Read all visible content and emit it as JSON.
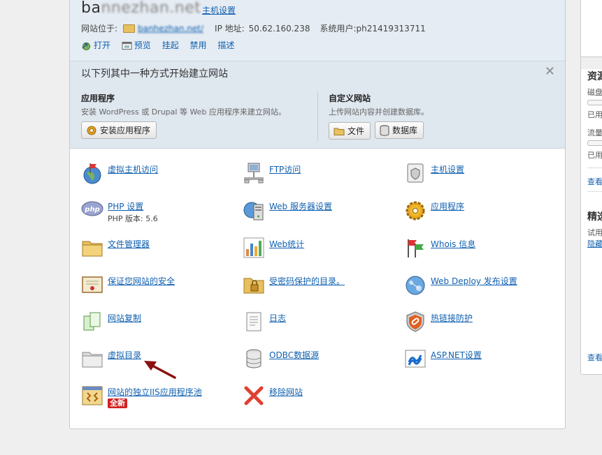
{
  "site": {
    "domain_visible": "ba",
    "domain_blurred": "nnezhan.net",
    "host_settings_link": "主机设置",
    "location_label": "网站位于:",
    "location_url_blurred": "banhezhan.net/",
    "ip_label": "IP 地址:",
    "ip_value": "50.62.160.238",
    "sysuser_label": "系统用户:",
    "sysuser_value": "ph21419313711",
    "actions": [
      {
        "label": "打开",
        "icon": "open-icon"
      },
      {
        "label": "预览",
        "icon": "preview-icon"
      },
      {
        "label": "挂起"
      },
      {
        "label": "禁用"
      },
      {
        "label": "描述"
      }
    ]
  },
  "start": {
    "title": "以下列其中一种方式开始建立网站",
    "close": "✕",
    "apps": {
      "title": "应用程序",
      "desc": "安装 WordPress 或 Drupal 等 Web 应用程序来建立网站。",
      "button": "安装应用程序"
    },
    "custom": {
      "title": "自定义网站",
      "desc": "上传网站内容并创建数据库。",
      "file_button": "文件",
      "db_button": "数据库"
    }
  },
  "tools": [
    {
      "label": "虚拟主机访问",
      "icon": "globe-flag-icon"
    },
    {
      "label": "FTP访问",
      "icon": "ftp-network-icon"
    },
    {
      "label": "主机设置",
      "icon": "hosting-settings-icon"
    },
    {
      "label": "PHP 设置",
      "sub": "PHP 版本: 5.6",
      "icon": "php-icon"
    },
    {
      "label": "Web 服务器设置",
      "icon": "web-server-icon"
    },
    {
      "label": "应用程序",
      "icon": "gear-icon"
    },
    {
      "label": "文件管理器",
      "icon": "folder-icon"
    },
    {
      "label": "Web统计",
      "icon": "bar-chart-icon"
    },
    {
      "label": "Whois 信息",
      "icon": "flags-icon"
    },
    {
      "label": "保证您网站的安全",
      "icon": "certificate-icon"
    },
    {
      "label": "受密码保护的目录。",
      "icon": "locked-folder-icon"
    },
    {
      "label": "Web Deploy 发布设置",
      "icon": "web-deploy-icon"
    },
    {
      "label": "网站复制",
      "icon": "copy-pages-icon"
    },
    {
      "label": "日志",
      "icon": "log-document-icon"
    },
    {
      "label": "热链接防护",
      "icon": "hotlink-shield-icon"
    },
    {
      "label": "虚拟目录",
      "icon": "virtual-directory-icon"
    },
    {
      "label": "ODBC数据源",
      "icon": "database-icon"
    },
    {
      "label": "ASP.NET设置",
      "icon": "aspnet-icon"
    },
    {
      "label": "网站的独立IIS应用程序池",
      "badge": "全新",
      "icon": "iis-pool-icon"
    },
    {
      "label": "移除网站",
      "icon": "remove-x-icon"
    }
  ],
  "right_panel": {
    "res_title": "资源",
    "disk_label": "磁盘",
    "disk_used": "已用",
    "traffic_label": "流量",
    "traffic_used": "已用",
    "view1": "查看",
    "featured_title": "精选",
    "trial_text": "试用",
    "privacy_link": "隐藏",
    "view2": "查看"
  },
  "colors": {
    "link": "#1060b0",
    "header_bg": "#e5ecf3",
    "start_bg": "#dfe7ef",
    "badge": "#d02020",
    "arrow": "#8b1010"
  }
}
